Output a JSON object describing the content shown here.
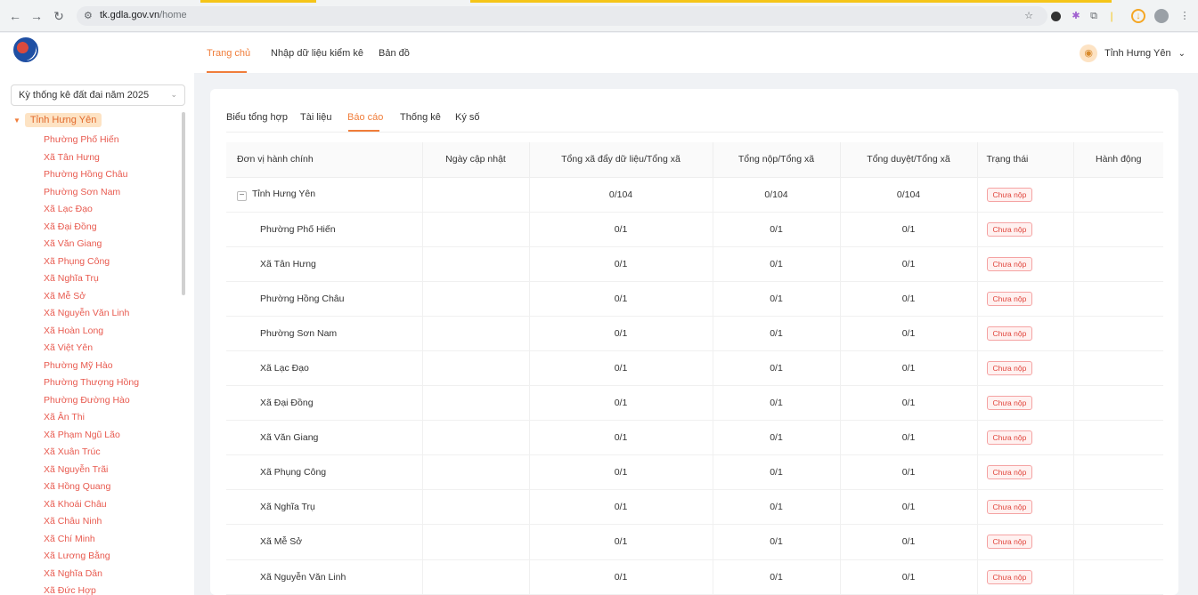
{
  "browser": {
    "url_host": "tk.gdla.gov.vn",
    "url_path": "/home"
  },
  "header": {
    "nav": [
      "Trang chủ",
      "Nhập dữ liệu kiểm kê",
      "Bản đồ"
    ],
    "user_name": "Tỉnh Hưng Yên"
  },
  "sidebar": {
    "year_select": "Kỳ thống kê đất đai năm 2025",
    "root": "Tỉnh Hưng Yên",
    "items": [
      "Phường Phố Hiến",
      "Xã Tân Hưng",
      "Phường Hồng Châu",
      "Phường Sơn Nam",
      "Xã Lạc Đạo",
      "Xã Đại Đồng",
      "Xã Văn Giang",
      "Xã Phụng Công",
      "Xã Nghĩa Trụ",
      "Xã Mễ Sở",
      "Xã Nguyễn Văn Linh",
      "Xã Hoàn Long",
      "Xã Việt Yên",
      "Phường Mỹ Hào",
      "Phường Thượng Hồng",
      "Phường Đường Hào",
      "Xã Ân Thi",
      "Xã Phạm Ngũ Lão",
      "Xã Xuân Trúc",
      "Xã Nguyễn Trãi",
      "Xã Hồng Quang",
      "Xã Khoái Châu",
      "Xã Châu Ninh",
      "Xã Chí Minh",
      "Xã Lương Bằng",
      "Xã Nghĩa Dân",
      "Xã Đức Hợp"
    ]
  },
  "tabs": [
    "Biểu tổng hợp",
    "Tài liệu",
    "Báo cáo",
    "Thống kê",
    "Ký số"
  ],
  "table": {
    "headers": [
      "Đơn vị hành chính",
      "Ngày cập nhật",
      "Tổng xã đẩy dữ liệu/Tổng xã",
      "Tổng nộp/Tổng xã",
      "Tổng duyệt/Tổng xã",
      "Trạng thái",
      "Hành động"
    ],
    "rows": [
      {
        "name": "Tỉnh Hưng Yên",
        "date": "",
        "pushed": "0/104",
        "submitted": "0/104",
        "approved": "0/104",
        "status": "Chưa nộp"
      },
      {
        "name": "Phường Phố Hiến",
        "date": "",
        "pushed": "0/1",
        "submitted": "0/1",
        "approved": "0/1",
        "status": "Chưa nộp"
      },
      {
        "name": "Xã Tân Hưng",
        "date": "",
        "pushed": "0/1",
        "submitted": "0/1",
        "approved": "0/1",
        "status": "Chưa nộp"
      },
      {
        "name": "Phường Hồng Châu",
        "date": "",
        "pushed": "0/1",
        "submitted": "0/1",
        "approved": "0/1",
        "status": "Chưa nộp"
      },
      {
        "name": "Phường Sơn Nam",
        "date": "",
        "pushed": "0/1",
        "submitted": "0/1",
        "approved": "0/1",
        "status": "Chưa nộp"
      },
      {
        "name": "Xã Lạc Đạo",
        "date": "",
        "pushed": "0/1",
        "submitted": "0/1",
        "approved": "0/1",
        "status": "Chưa nộp"
      },
      {
        "name": "Xã Đại Đồng",
        "date": "",
        "pushed": "0/1",
        "submitted": "0/1",
        "approved": "0/1",
        "status": "Chưa nộp"
      },
      {
        "name": "Xã Văn Giang",
        "date": "",
        "pushed": "0/1",
        "submitted": "0/1",
        "approved": "0/1",
        "status": "Chưa nộp"
      },
      {
        "name": "Xã Phụng Công",
        "date": "",
        "pushed": "0/1",
        "submitted": "0/1",
        "approved": "0/1",
        "status": "Chưa nộp"
      },
      {
        "name": "Xã Nghĩa Trụ",
        "date": "",
        "pushed": "0/1",
        "submitted": "0/1",
        "approved": "0/1",
        "status": "Chưa nộp"
      },
      {
        "name": "Xã Mễ Sở",
        "date": "",
        "pushed": "0/1",
        "submitted": "0/1",
        "approved": "0/1",
        "status": "Chưa nộp"
      },
      {
        "name": "Xã Nguyễn Văn Linh",
        "date": "",
        "pushed": "0/1",
        "submitted": "0/1",
        "approved": "0/1",
        "status": "Chưa nộp"
      }
    ]
  }
}
